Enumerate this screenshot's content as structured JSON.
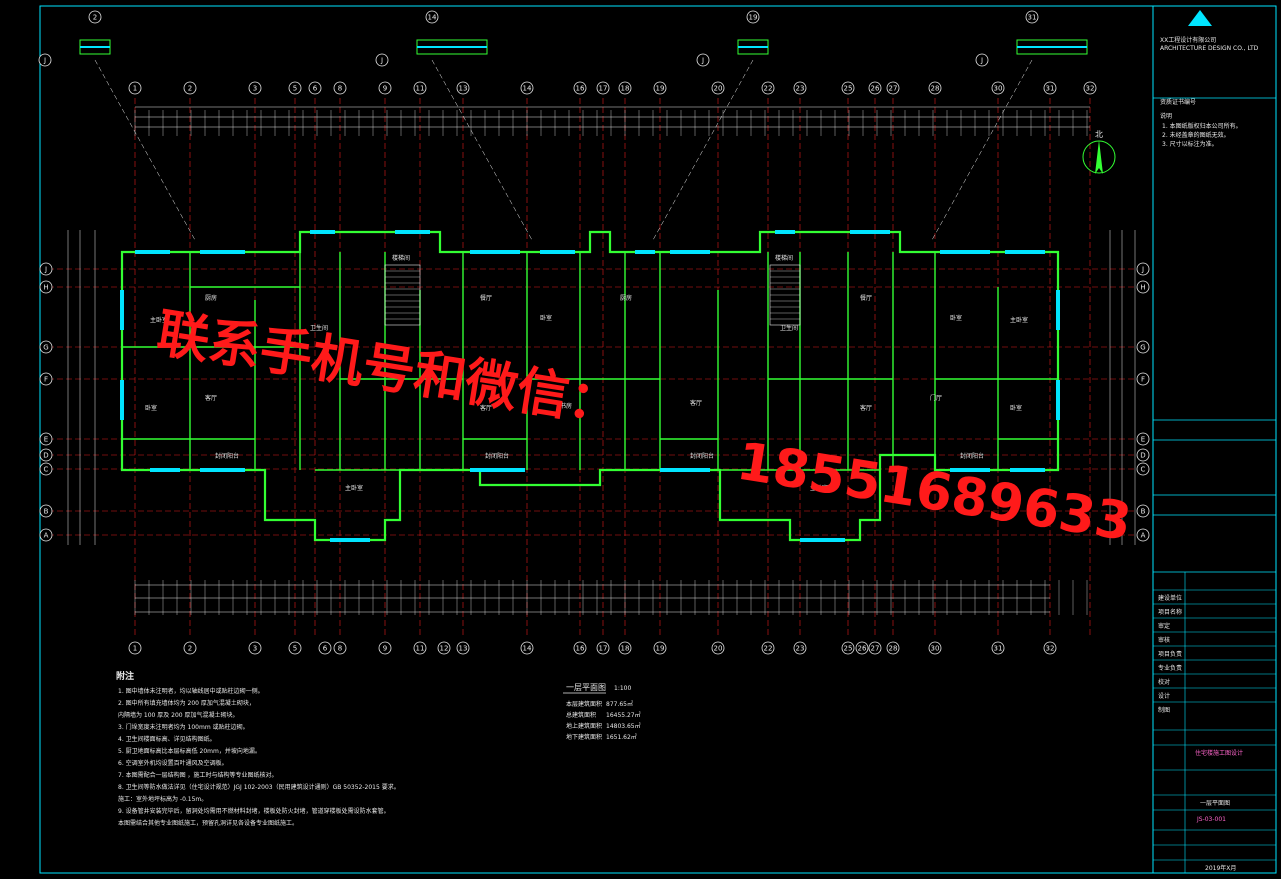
{
  "drawing": {
    "title": "一层平面图",
    "scale": "1:100",
    "north_label": "北",
    "area_table": [
      {
        "label": "本层建筑面积",
        "value": "877.65㎡"
      },
      {
        "label": "总建筑面积",
        "value": "16455.27㎡"
      },
      {
        "label": "地上建筑面积",
        "value": "14803.65㎡"
      },
      {
        "label": "地下建筑面积",
        "value": "1651.62㎡"
      }
    ]
  },
  "axes": {
    "top": [
      "1",
      "2",
      "3",
      "5",
      "6",
      "8",
      "9",
      "11",
      "13",
      "14",
      "16",
      "17",
      "18",
      "19",
      "20",
      "22",
      "23",
      "25",
      "26",
      "27",
      "28",
      "30",
      "31",
      "32"
    ],
    "bottom": [
      "1",
      "2",
      "3",
      "5",
      "6",
      "8",
      "9",
      "11",
      "12",
      "13",
      "14",
      "16",
      "17",
      "18",
      "19",
      "20",
      "22",
      "23",
      "25",
      "26",
      "27",
      "28",
      "30",
      "31",
      "32"
    ],
    "left": [
      "J",
      "H",
      "G",
      "F",
      "E",
      "D",
      "C",
      "B",
      "A"
    ],
    "detail_tags": [
      "2",
      "14",
      "19",
      "31"
    ]
  },
  "notes": {
    "heading": "附注",
    "items": [
      "1. 图中墙体未注明者，均以轴线居中或贴柱边砌一侧。",
      "2. 图中所有填充墙体均为 200 厚加气混凝土砌块，",
      "   内隔墙为 100 厚及 200 厚加气混凝土砌块。",
      "3. 门垛宽度未注明者均为 100mm 或贴柱边砌。",
      "4. 卫生间楼面标高、详见结构图纸。",
      "5. 厨卫地面标高比本层标高低 20mm，并坡向地漏。",
      "6. 空调室外机均设置百叶通风及空调板。",
      "7. 本图需配合一层结构图 ，施工时与结构等专业图纸核对。",
      "8. 卫生间等防水做法详见（住宅设计规范）JGJ 102-2003（民用建筑设计通则）GB 50352-2015 要求。",
      "   施工：室外地坪标高为 -0.15m。",
      "9. 设备管井安装完毕后，留洞处均需用不燃材料封堵，楼板处防火封堵，管道穿楼板处需设防水套管。",
      "   本图需结合其他专业图纸施工，预留孔洞详见各设备专业图纸施工。"
    ]
  },
  "rooms": {
    "living": "客厅",
    "master": "主卧室",
    "bedroom": "卧室",
    "kitchen": "厨房",
    "bath": "卫生间",
    "dining": "餐厅",
    "stair": "楼梯间",
    "balcony": "封闭阳台",
    "hall": "门厅",
    "study": "书房"
  },
  "title_block": {
    "company": "XX工程设计有限公司",
    "company_en": "ARCHITECTURE DESIGN CO., LTD",
    "cert_note": "资质证书编号",
    "notes_heading": "说明",
    "note_lines": [
      "1. 本图纸版权归本公司所有。",
      "2. 未经盖章的图纸无效。",
      "3. 尺寸以标注为准。"
    ],
    "rows": [
      {
        "k": "建设单位",
        "v": ""
      },
      {
        "k": "项目名称",
        "v": ""
      },
      {
        "k": "审定",
        "v": ""
      },
      {
        "k": "审核",
        "v": ""
      },
      {
        "k": "项目负责",
        "v": ""
      },
      {
        "k": "专业负责",
        "v": ""
      },
      {
        "k": "校对",
        "v": ""
      },
      {
        "k": "设计",
        "v": ""
      },
      {
        "k": "制图",
        "v": ""
      }
    ],
    "project_name": "住宅楼施工图设计",
    "drawing_name": "一层平面图",
    "drawing_no": "JS-03-001",
    "date": "2019年X月"
  },
  "watermark": {
    "line1": "联系手机号和微信：",
    "phone": "18551689633"
  },
  "colors": {
    "background": "#000000",
    "axis": "#e01c1c",
    "wall": "#33ff33",
    "window": "#00e5ff",
    "dimension": "#e8e8e8",
    "frame": "#00e5ff",
    "watermark": "#ff1a1a",
    "accent": "#ff66cc"
  }
}
